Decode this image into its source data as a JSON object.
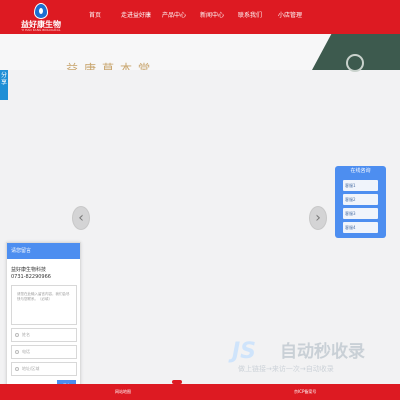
{
  "logo": {
    "name": "益好康生物",
    "subtitle": "YI HAO KANG BIOLOGICAL"
  },
  "nav": {
    "items": [
      "首页",
      "走进益好康",
      "产品中心",
      "新闻中心",
      "联系我们",
      "小店管理"
    ]
  },
  "banner": {
    "headline": "益康草本堂"
  },
  "carousel": {
    "prev_glyph": "‹",
    "next_glyph": "›"
  },
  "side_tab": {
    "label": "分享"
  },
  "online": {
    "title": "在线咨询",
    "items": [
      "客服1",
      "客服2",
      "客服3",
      "客服4"
    ]
  },
  "message": {
    "title": "请您留言",
    "company": "益好康生物科技",
    "phone": "0731-82290966",
    "textarea_placeholder": "请您在此输入留言内容，我们会尽快与您联系。（必填）",
    "name_placeholder": "姓名",
    "phone_placeholder": "电话",
    "address_placeholder": "地址/区域",
    "submit_label": "提交"
  },
  "footer": {
    "left_text": "网站地图",
    "sitemap_label": "网站地图",
    "right_text": "京ICP备案号"
  },
  "watermark": {
    "title": "自动秒收录",
    "subtitle": "做上链接→来访一次→自动收录"
  },
  "colors": {
    "brand_red": "#dd1a22",
    "accent_blue": "#4d8ef0"
  }
}
